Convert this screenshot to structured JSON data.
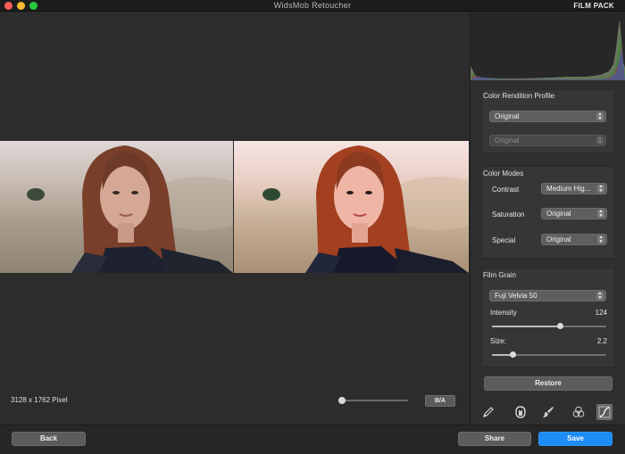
{
  "window": {
    "title": "WidsMob Retoucher",
    "section": "FILM PACK"
  },
  "canvas": {
    "dimensions": "3128 x 1762 Pixel",
    "zoom_level": 0.05,
    "ba_label": "B/A",
    "before_image": "portrait-photo-original",
    "after_image": "portrait-photo-film-pack"
  },
  "color_rendition": {
    "title": "Color Rendition Profile",
    "primary_value": "Original",
    "secondary_value": "Original"
  },
  "color_modes": {
    "title": "Color Modes",
    "rows": [
      {
        "label": "Contrast",
        "value": "Medium Hig..."
      },
      {
        "label": "Saturation",
        "value": "Original"
      },
      {
        "label": "Special",
        "value": "Original"
      }
    ]
  },
  "film_grain": {
    "title": "Film Grain",
    "film": "Fuji Velvia 50",
    "intensity_label": "Intensity",
    "intensity_value": "124",
    "intensity_fraction": 0.6,
    "size_label": "Size:",
    "size_value": "2.2",
    "size_fraction": 0.18
  },
  "restore_label": "Restore",
  "tools": [
    {
      "icon": "pencil-icon"
    },
    {
      "icon": "face-icon"
    },
    {
      "icon": "brush-icon"
    },
    {
      "icon": "color-circles-icon"
    },
    {
      "icon": "curve-icon",
      "active": true
    }
  ],
  "footer": {
    "back_label": "Back",
    "share_label": "Share",
    "save_label": "Save"
  },
  "colors": {
    "accent": "#1e8cf5"
  }
}
